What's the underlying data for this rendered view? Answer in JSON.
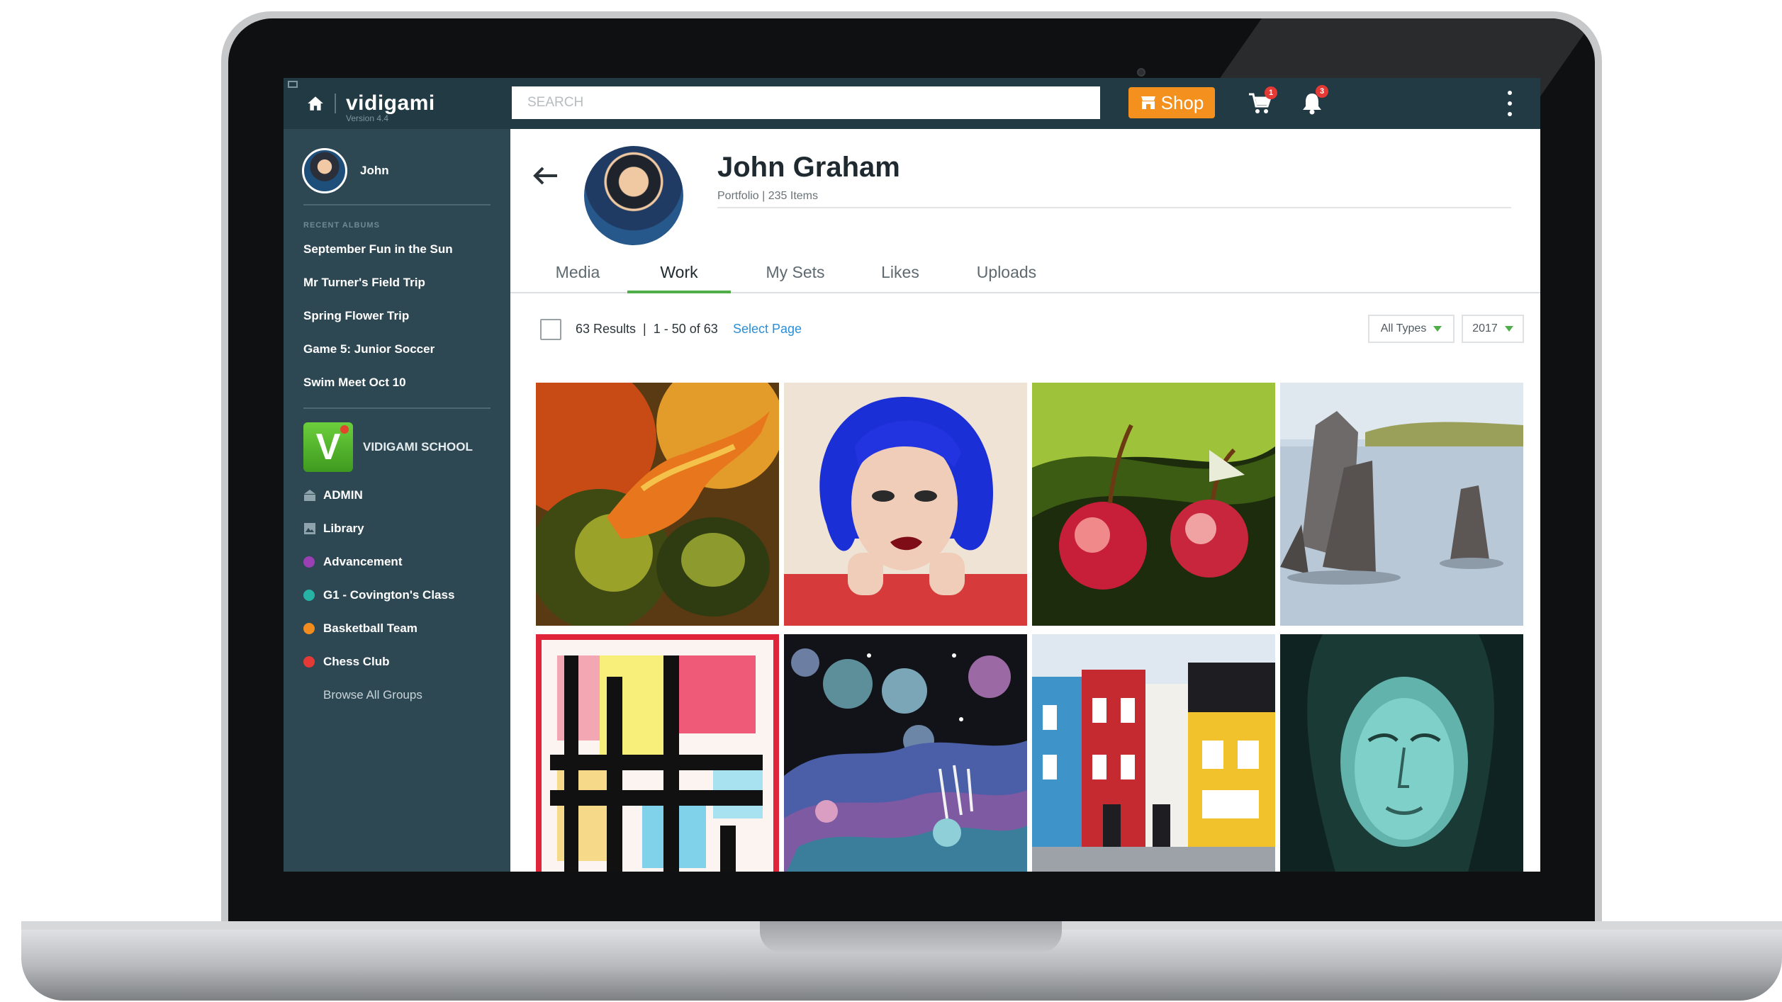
{
  "app": {
    "logo": "vidigami",
    "version": "Version 4.4"
  },
  "search": {
    "placeholder": "SEARCH"
  },
  "header": {
    "shop_label": "Shop",
    "cart_count": "1",
    "notification_count": "3"
  },
  "sidebar": {
    "user_name": "John",
    "recent_albums_heading": "RECENT ALBUMS",
    "albums": [
      "September Fun in the Sun",
      "Mr Turner's Field Trip",
      "Spring Flower Trip",
      "Game 5: Junior Soccer",
      "Swim Meet Oct 10"
    ],
    "school_logo_letter": "V",
    "school_name": "VIDIGAMI SCHOOL",
    "admin_label": "ADMIN",
    "library_label": "Library",
    "groups": [
      {
        "label": "Advancement",
        "color": "#9b3fb5"
      },
      {
        "label": "G1 - Covington's Class",
        "color": "#26b3a6"
      },
      {
        "label": "Basketball Team",
        "color": "#f28c1e"
      },
      {
        "label": "Chess Club",
        "color": "#e53935"
      }
    ],
    "browse_all": "Browse All Groups"
  },
  "profile": {
    "name": "John Graham",
    "subline": "Portfolio | 235 Items"
  },
  "tabs": [
    "Media",
    "Work",
    "My Sets",
    "Likes",
    "Uploads"
  ],
  "active_tab": "Work",
  "results": {
    "count_text": "63 Results  |  1 - 50 of 63",
    "select_page": "Select Page"
  },
  "filters": {
    "type": "All Types",
    "year": "2017"
  },
  "artworks": [
    "still-life-pear-painting",
    "blue-hair-portrait",
    "cherries-painting",
    "sea-stacks-landscape",
    "mondrian-style-abstract",
    "space-planets-collage",
    "colorful-row-houses",
    "teal-face-portrait"
  ],
  "colors": {
    "sidebar_bg": "#2d4853",
    "topbar_bg": "#223a44",
    "shop_orange": "#f4911e",
    "active_tab_green": "#4fae4a",
    "link_blue": "#2a8fd8"
  }
}
